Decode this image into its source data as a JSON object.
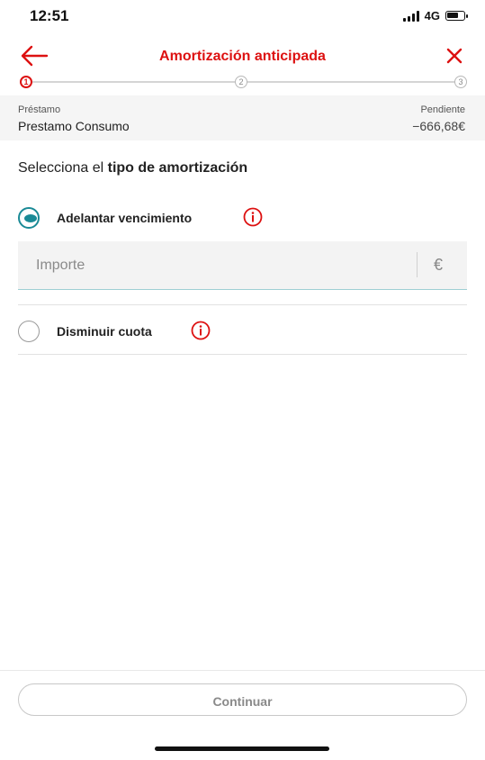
{
  "status_bar": {
    "time": "12:51",
    "network": "4G"
  },
  "header": {
    "title": "Amortización anticipada"
  },
  "stepper": {
    "steps": [
      "1",
      "2",
      "3"
    ]
  },
  "loan": {
    "left_label": "Préstamo",
    "left_value": "Prestamo Consumo",
    "right_label": "Pendiente",
    "right_value": "−666,68€"
  },
  "section": {
    "title_prefix": "Selecciona el ",
    "title_bold": "tipo de amortización"
  },
  "options": [
    {
      "label": "Adelantar vencimiento",
      "selected": true
    },
    {
      "label": "Disminuir cuota",
      "selected": false
    }
  ],
  "amount": {
    "placeholder": "Importe",
    "currency": "€"
  },
  "footer": {
    "continue_label": "Continuar"
  },
  "colors": {
    "accent_red": "#dd1111",
    "teal": "#1a8a96"
  }
}
